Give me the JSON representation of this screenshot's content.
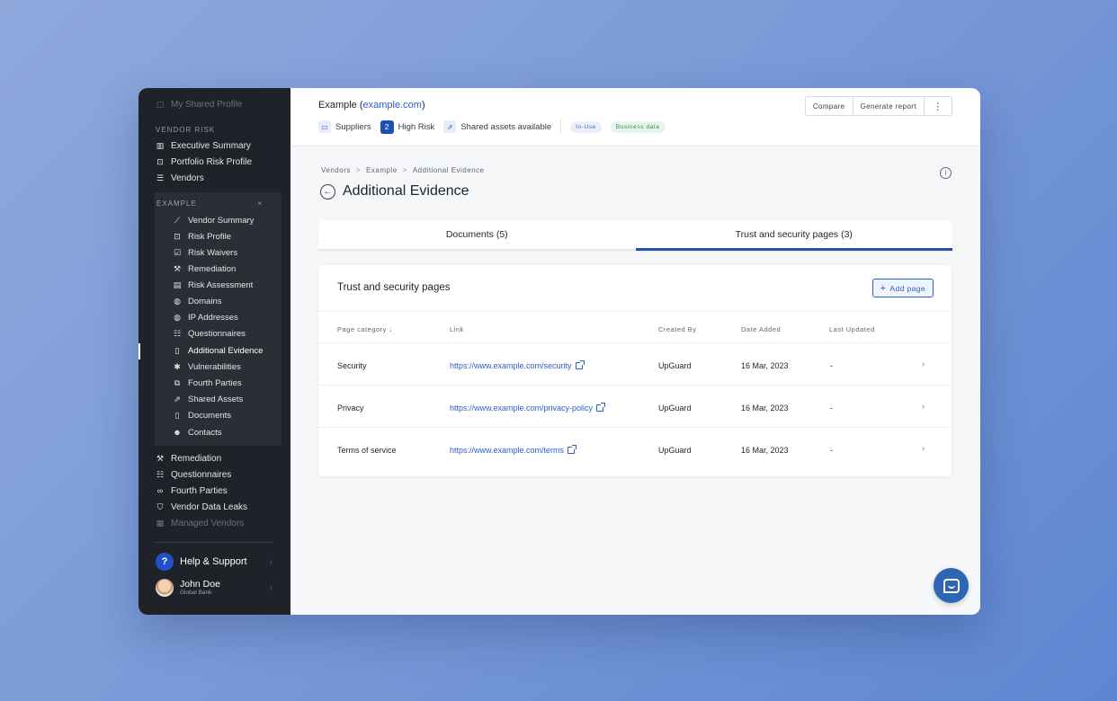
{
  "sidebar": {
    "top_item": "My Shared Profile",
    "section_label": "VENDOR RISK",
    "main_items": [
      "Executive Summary",
      "Portfolio Risk Profile",
      "Vendors"
    ],
    "sub_header": "EXAMPLE",
    "sub_close": "×",
    "sub_items": [
      "Vendor Summary",
      "Risk Profile",
      "Risk Waivers",
      "Remediation",
      "Risk Assessment",
      "Domains",
      "IP Addresses",
      "Questionnaires",
      "Additional Evidence",
      "Vulnerabilities",
      "Fourth Parties",
      "Shared Assets",
      "Documents",
      "Contacts"
    ],
    "active_sub_item": "Additional Evidence",
    "lower_items": [
      "Remediation",
      "Questionnaires",
      "Fourth Parties",
      "Vendor Data Leaks",
      "Managed Vendors"
    ],
    "help_label": "Help & Support",
    "help_icon": "?",
    "user_name": "John Doe",
    "user_org": "Global Bank"
  },
  "header": {
    "vendor_name": "Example",
    "vendor_domain_open": " (",
    "vendor_domain": "example.com",
    "vendor_domain_close": ")",
    "suppliers_label": "Suppliers",
    "risk_count": "2",
    "risk_label": "High Risk",
    "shared_assets_label": "Shared assets available",
    "tag_in_use": "In-Use",
    "tag_business": "Business data",
    "compare_label": "Compare",
    "report_label": "Generate report",
    "more_label": "⋮"
  },
  "breadcrumb": [
    "Vendors",
    "Example",
    "Additional Evidence"
  ],
  "breadcrumb_sep": ">",
  "page_title": "Additional Evidence",
  "tabs": [
    {
      "label": "Documents (5)",
      "active": false
    },
    {
      "label": "Trust and security pages (3)",
      "active": true
    }
  ],
  "card": {
    "title": "Trust and security pages",
    "add_label": "Add page",
    "add_icon": "+",
    "columns": [
      "Page category ↓",
      "Link",
      "Created By",
      "Date Added",
      "Last Updated"
    ],
    "rows": [
      {
        "category": "Security",
        "link": "https://www.example.com/security",
        "created_by": "UpGuard",
        "date_added": "16 Mar, 2023",
        "last_updated": "-"
      },
      {
        "category": "Privacy",
        "link": "https://www.example.com/privacy-policy",
        "created_by": "UpGuard",
        "date_added": "16 Mar, 2023",
        "last_updated": "-"
      },
      {
        "category": "Terms of service",
        "link": "https://www.example.com/terms",
        "created_by": "UpGuard",
        "date_added": "16 Mar, 2023",
        "last_updated": "-"
      }
    ]
  },
  "icons": {
    "chevron_right": "›",
    "info": "i",
    "back": "←",
    "close": "×"
  },
  "colors": {
    "accent": "#2350b4",
    "link": "#2c5fc5",
    "sidebar_bg": "#1f2228"
  }
}
